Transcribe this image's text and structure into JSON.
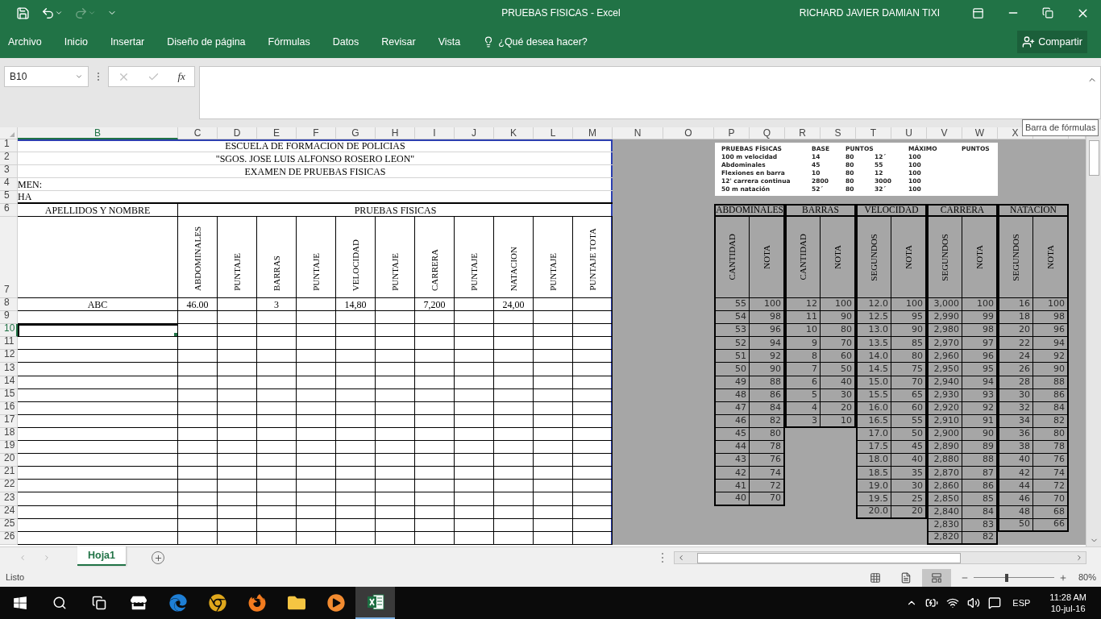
{
  "title_bar": {
    "quick_access": [
      {
        "kind": "save",
        "disabled": false
      },
      {
        "kind": "undo",
        "disabled": false
      },
      {
        "kind": "redo",
        "disabled": true
      },
      {
        "kind": "customize",
        "disabled": false
      }
    ],
    "title": "PRUEBAS FISICAS - Excel",
    "user": "RICHARD JAVIER DAMIAN TIXI"
  },
  "ribbon": {
    "tabs": [
      "Archivo",
      "Inicio",
      "Insertar",
      "Diseño de página",
      "Fórmulas",
      "Datos",
      "Revisar",
      "Vista"
    ],
    "tell_me": "¿Qué desea hacer?",
    "share": "Compartir"
  },
  "formula_bar": {
    "name_box": "B10",
    "buttons": [
      {
        "kind": "cancel",
        "disabled": true
      },
      {
        "kind": "enter",
        "disabled": true
      }
    ],
    "function_label": "fx",
    "tooltip": "Barra de fórmulas"
  },
  "sheet": {
    "columns": [
      {
        "label": "B",
        "selected": true
      },
      {
        "label": "C",
        "selected": false
      },
      {
        "label": "D",
        "selected": false
      },
      {
        "label": "E",
        "selected": false
      },
      {
        "label": "F",
        "selected": false
      },
      {
        "label": "G",
        "selected": false
      },
      {
        "label": "H",
        "selected": false
      },
      {
        "label": "I",
        "selected": false
      },
      {
        "label": "J",
        "selected": false
      },
      {
        "label": "K",
        "selected": false
      },
      {
        "label": "L",
        "selected": false
      },
      {
        "label": "M",
        "selected": false
      },
      {
        "label": "N",
        "selected": false
      },
      {
        "label": "O",
        "selected": false
      },
      {
        "label": "P",
        "selected": false
      },
      {
        "label": "Q",
        "selected": false
      },
      {
        "label": "R",
        "selected": false
      },
      {
        "label": "S",
        "selected": false
      },
      {
        "label": "T",
        "selected": false
      },
      {
        "label": "U",
        "selected": false
      },
      {
        "label": "V",
        "selected": false
      },
      {
        "label": "W",
        "selected": false
      },
      {
        "label": "X",
        "selected": false
      }
    ],
    "rows": [
      {
        "number": "1",
        "selected": false
      },
      {
        "number": "2",
        "selected": false
      },
      {
        "number": "3",
        "selected": false
      },
      {
        "number": "4",
        "selected": false
      },
      {
        "number": "5",
        "selected": false
      },
      {
        "number": "6",
        "selected": false
      },
      {
        "number": "7",
        "selected": false
      },
      {
        "number": "8",
        "selected": false
      },
      {
        "number": "9",
        "selected": false
      },
      {
        "number": "10",
        "selected": true
      },
      {
        "number": "11",
        "selected": false
      },
      {
        "number": "12",
        "selected": false
      },
      {
        "number": "13",
        "selected": false
      },
      {
        "number": "14",
        "selected": false
      },
      {
        "number": "15",
        "selected": false
      },
      {
        "number": "16",
        "selected": false
      },
      {
        "number": "17",
        "selected": false
      },
      {
        "number": "18",
        "selected": false
      },
      {
        "number": "19",
        "selected": false
      },
      {
        "number": "20",
        "selected": false
      },
      {
        "number": "21",
        "selected": false
      },
      {
        "number": "22",
        "selected": false
      },
      {
        "number": "23",
        "selected": false
      },
      {
        "number": "24",
        "selected": false
      },
      {
        "number": "25",
        "selected": false
      },
      {
        "number": "26",
        "selected": false
      }
    ],
    "header_lines": [
      "ESCUELA DE FORMACION DE POLICIAS",
      "\"SGOS. JOSE LUIS ALFONSO ROSERO LEON\"",
      "EXAMEN DE PRUEBAS FISICAS"
    ],
    "info_labels": [
      "MEN:",
      "HA"
    ],
    "name_heading": "APELLIDOS Y NOMBRE",
    "tests_heading": "PRUEBAS FISICAS",
    "column_headings": [
      "ABDOMINALES",
      "PUNTAJE",
      "BARRAS",
      "PUNTAJE",
      "VELOCIDAD",
      "PUNTAJE",
      "CARRERA",
      "PUNTAJE",
      "NATACION",
      "PUNTAJE",
      "PUNTAJE TOTA"
    ],
    "students": [
      {
        "name": "ABC",
        "results": [
          "46.00",
          "3",
          "14,80",
          "7,200",
          "24,00"
        ]
      }
    ],
    "reference_image": {
      "header": [
        "PRUEBAS FÍSICAS",
        "BASE",
        "PUNTOS",
        "MÁXIMO",
        "PUNTOS"
      ],
      "rows": [
        [
          "100 m velocidad",
          "14",
          "80",
          "12´",
          "100"
        ],
        [
          "Abdominales",
          "45",
          "80",
          "55",
          "100"
        ],
        [
          "Flexiones en barra",
          "10",
          "80",
          "12",
          "100"
        ],
        [
          "12' carrera continua",
          "2800",
          "80",
          "3000",
          "100"
        ],
        [
          "50 m natación",
          "52´",
          "80",
          "32´",
          "100"
        ]
      ]
    },
    "score_tables": [
      {
        "title": "ABDOMINALES",
        "columns": [
          "CANTIDAD",
          "NOTA"
        ],
        "rows": [
          [
            "55",
            "100"
          ],
          [
            "54",
            "98"
          ],
          [
            "53",
            "96"
          ],
          [
            "52",
            "94"
          ],
          [
            "51",
            "92"
          ],
          [
            "50",
            "90"
          ],
          [
            "49",
            "88"
          ],
          [
            "48",
            "86"
          ],
          [
            "47",
            "84"
          ],
          [
            "46",
            "82"
          ],
          [
            "45",
            "80"
          ],
          [
            "44",
            "78"
          ],
          [
            "43",
            "76"
          ],
          [
            "42",
            "74"
          ],
          [
            "41",
            "72"
          ],
          [
            "40",
            "70"
          ]
        ]
      },
      {
        "title": "BARRAS",
        "columns": [
          "CANTIDAD",
          "NOTA"
        ],
        "rows": [
          [
            "12",
            "100"
          ],
          [
            "11",
            "90"
          ],
          [
            "10",
            "80"
          ],
          [
            "9",
            "70"
          ],
          [
            "8",
            "60"
          ],
          [
            "7",
            "50"
          ],
          [
            "6",
            "40"
          ],
          [
            "5",
            "30"
          ],
          [
            "4",
            "20"
          ],
          [
            "3",
            "10"
          ]
        ]
      },
      {
        "title": "VELOCIDAD",
        "columns": [
          "SEGUNDOS",
          "NOTA"
        ],
        "rows": [
          [
            "12.0",
            "100"
          ],
          [
            "12.5",
            "95"
          ],
          [
            "13.0",
            "90"
          ],
          [
            "13.5",
            "85"
          ],
          [
            "14.0",
            "80"
          ],
          [
            "14.5",
            "75"
          ],
          [
            "15.0",
            "70"
          ],
          [
            "15.5",
            "65"
          ],
          [
            "16.0",
            "60"
          ],
          [
            "16.5",
            "55"
          ],
          [
            "17.0",
            "50"
          ],
          [
            "17.5",
            "45"
          ],
          [
            "18.0",
            "40"
          ],
          [
            "18.5",
            "35"
          ],
          [
            "19.0",
            "30"
          ],
          [
            "19.5",
            "25"
          ],
          [
            "20.0",
            "20"
          ]
        ]
      },
      {
        "title": "CARRERA",
        "columns": [
          "SEGUNDOS",
          "NOTA"
        ],
        "rows": [
          [
            "3,000",
            "100"
          ],
          [
            "2,990",
            "99"
          ],
          [
            "2,980",
            "98"
          ],
          [
            "2,970",
            "97"
          ],
          [
            "2,960",
            "96"
          ],
          [
            "2,950",
            "95"
          ],
          [
            "2,940",
            "94"
          ],
          [
            "2,930",
            "93"
          ],
          [
            "2,920",
            "92"
          ],
          [
            "2,910",
            "91"
          ],
          [
            "2,900",
            "90"
          ],
          [
            "2,890",
            "89"
          ],
          [
            "2,880",
            "88"
          ],
          [
            "2,870",
            "87"
          ],
          [
            "2,860",
            "86"
          ],
          [
            "2,850",
            "85"
          ],
          [
            "2,840",
            "84"
          ],
          [
            "2,830",
            "83"
          ],
          [
            "2,820",
            "82"
          ]
        ]
      },
      {
        "title": "NATACION",
        "columns": [
          "SEGUNDOS",
          "NOTA"
        ],
        "rows": [
          [
            "16",
            "100"
          ],
          [
            "18",
            "98"
          ],
          [
            "20",
            "96"
          ],
          [
            "22",
            "94"
          ],
          [
            "24",
            "92"
          ],
          [
            "26",
            "90"
          ],
          [
            "28",
            "88"
          ],
          [
            "30",
            "86"
          ],
          [
            "32",
            "84"
          ],
          [
            "34",
            "82"
          ],
          [
            "36",
            "80"
          ],
          [
            "38",
            "78"
          ],
          [
            "40",
            "76"
          ],
          [
            "42",
            "74"
          ],
          [
            "44",
            "72"
          ],
          [
            "46",
            "70"
          ],
          [
            "48",
            "68"
          ],
          [
            "50",
            "66"
          ]
        ]
      }
    ]
  },
  "sheet_tabs": [
    {
      "label": "Hoja1",
      "selected": true
    }
  ],
  "status_bar": {
    "status": "Listo",
    "views": [
      {
        "kind": "normal",
        "selected": false
      },
      {
        "kind": "page-layout",
        "selected": false
      },
      {
        "kind": "page-break",
        "selected": true
      }
    ],
    "zoom": {
      "level": 0.41,
      "label": "80%"
    }
  },
  "taskbar": {
    "apps": [
      {
        "kind": "start",
        "selected": false
      },
      {
        "kind": "search",
        "selected": false
      },
      {
        "kind": "task-view",
        "selected": false
      },
      {
        "kind": "store",
        "selected": false
      },
      {
        "kind": "edge",
        "selected": false
      },
      {
        "kind": "chrome",
        "selected": false
      },
      {
        "kind": "firefox",
        "selected": false
      },
      {
        "kind": "explorer",
        "selected": false
      },
      {
        "kind": "media",
        "selected": false
      },
      {
        "kind": "excel",
        "selected": true
      }
    ],
    "language": "ESP",
    "time": "11:28 AM",
    "date": "10-jul-16"
  }
}
